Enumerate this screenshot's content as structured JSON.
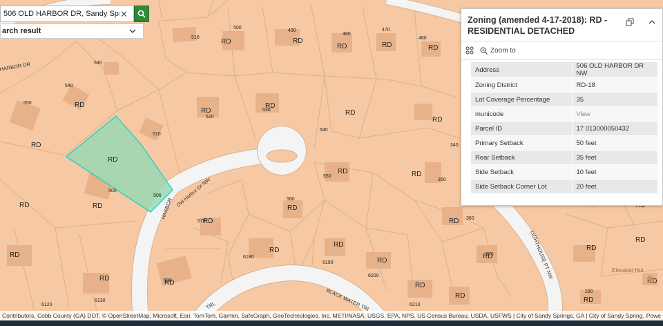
{
  "search": {
    "value": "506 OLD HARBOR DR, Sandy Spri...",
    "result_label": "arch result"
  },
  "panel": {
    "title": "Zoning (amended 4-17-2018): RD - RESIDENTIAL DETACHED",
    "zoom_label": "Zoom to",
    "attributes": [
      {
        "key": "Address",
        "value": "506 OLD HARBOR DR NW"
      },
      {
        "key": "Zoning District",
        "value": "RD-18"
      },
      {
        "key": "Lot Coverage Percentage",
        "value": "35"
      },
      {
        "key": "municode",
        "value": "View"
      },
      {
        "key": "Parcel ID",
        "value": "17 013000050432"
      },
      {
        "key": "Primary Setback",
        "value": "50 feet"
      },
      {
        "key": "Rear Setback",
        "value": "35 feet"
      },
      {
        "key": "Side Setback",
        "value": "10 feet"
      },
      {
        "key": "Side Setback Corner Lot",
        "value": "20 feet"
      }
    ]
  },
  "map": {
    "zone_labels": [
      "RD",
      "RD",
      "RD",
      "RD",
      "RD",
      "RD",
      "RD",
      "RD",
      "RD",
      "RD",
      "RD",
      "RD",
      "RD",
      "RD",
      "RD",
      "RD",
      "RD",
      "RD",
      "RD",
      "RD",
      "RD",
      "RD",
      "RD",
      "RD",
      "RD",
      "RD",
      "RD",
      "RD",
      "RD",
      "RD",
      "RD",
      "RD",
      "RD"
    ],
    "parcel_numbers": [
      "510",
      "500",
      "490",
      "480",
      "470",
      "460",
      "530",
      "540",
      "550",
      "520",
      "530",
      "540",
      "340",
      "510",
      "500",
      "506",
      "550",
      "350",
      "560",
      "570",
      "360",
      "370",
      "6180",
      "6190",
      "6200",
      "6210",
      "580",
      "6130",
      "6120",
      "290"
    ],
    "road_labels": [
      "Old Harbor Dr NW",
      "HARBOR DR",
      "HARBOR",
      "BLACK WATER TRL",
      "LIGHTHOUSE PT NW",
      "TRL"
    ],
    "poi_label": "Elevated Hut"
  },
  "attribution": {
    "text": "Contributors, Cobb County (GA) DOT, © OpenStreetMap, Microsoft, Esri, TomTom, Garmin, SafeGraph, GeoTechnologies, Inc, METI/NASA, USGS, EPA, NPS, US Census Bureau, USDA, USFWS | City of Sandy Springs, GA | City of Sandy Spring...",
    "powered": "Powe"
  },
  "colors": {
    "parcel_fill": "#f6c9a4",
    "parcel_line": "#d9b08c",
    "building": "#e7b28a",
    "selection_fill": "#9ad8b4",
    "selection_stroke": "#2fd3c0",
    "road": "#f4f4f4",
    "search_button": "#2e8a3a"
  }
}
